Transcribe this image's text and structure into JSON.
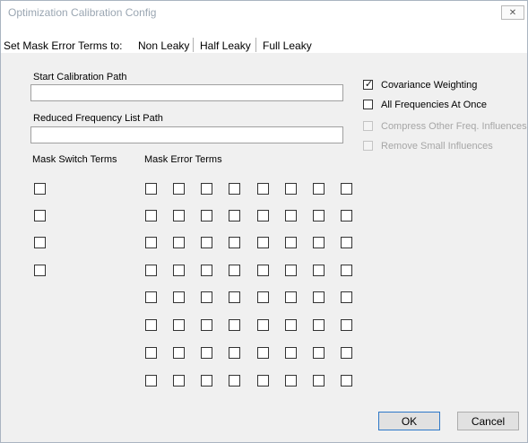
{
  "window": {
    "title": "Optimization Calibration Config",
    "close_glyph": "✕"
  },
  "mask_bar": {
    "label": "Set Mask Error Terms to:",
    "options": [
      "Non Leaky",
      "Half Leaky",
      "Full Leaky"
    ]
  },
  "paths": {
    "start_label": "Start Calibration Path",
    "start_value": "",
    "reduced_label": "Reduced Frequency List Path",
    "reduced_value": ""
  },
  "masks": {
    "switch_label": "Mask Switch Terms",
    "error_label": "Mask Error Terms",
    "switch_checked": [
      false,
      false,
      false,
      false
    ],
    "error_checked": [
      [
        false,
        false,
        false,
        false,
        false,
        false,
        false,
        false
      ],
      [
        false,
        false,
        false,
        false,
        false,
        false,
        false,
        false
      ],
      [
        false,
        false,
        false,
        false,
        false,
        false,
        false,
        false
      ],
      [
        false,
        false,
        false,
        false,
        false,
        false,
        false,
        false
      ],
      [
        false,
        false,
        false,
        false,
        false,
        false,
        false,
        false
      ],
      [
        false,
        false,
        false,
        false,
        false,
        false,
        false,
        false
      ],
      [
        false,
        false,
        false,
        false,
        false,
        false,
        false,
        false
      ],
      [
        false,
        false,
        false,
        false,
        false,
        false,
        false,
        false
      ]
    ]
  },
  "options": [
    {
      "label": "Covariance Weighting",
      "checked": true,
      "enabled": true
    },
    {
      "label": "All Frequencies At Once",
      "checked": false,
      "enabled": true
    },
    {
      "label": "Compress Other Freq. Influences",
      "checked": false,
      "enabled": false
    },
    {
      "label": "Remove Small Influences",
      "checked": false,
      "enabled": false
    }
  ],
  "buttons": {
    "ok": "OK",
    "cancel": "Cancel"
  },
  "check_glyph": "✓"
}
